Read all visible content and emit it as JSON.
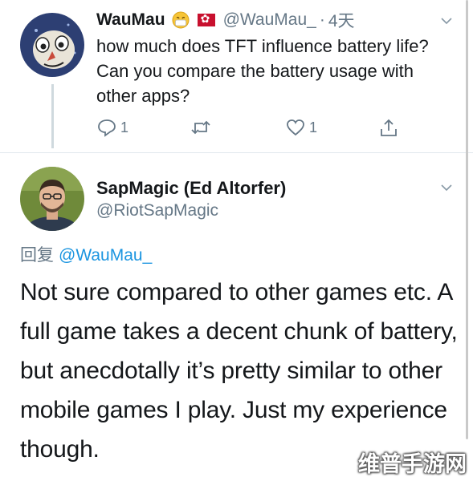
{
  "tweet1": {
    "display_name": "WauMau",
    "handle": "@WauMau_",
    "separator": "·",
    "time": "4天",
    "text": "how much does TFT influence battery life? Can you compare the battery usage with other apps?",
    "reply_count": "1",
    "like_count": "1",
    "badge_icon": "face-with-mask-emoji-icon",
    "flag_icon": "hong-kong-flag-icon"
  },
  "tweet2": {
    "display_name": "SapMagic (Ed Altorfer)",
    "handle": "@RiotSapMagic",
    "reply_prefix": "回复",
    "reply_to": "@WauMau_",
    "text": "Not sure compared to other games etc. A full game takes a decent chunk of battery, but anecdotally it’s pretty similar to other mobile games I play. Just my experience though."
  },
  "watermark": "维普手游网",
  "colors": {
    "secondary_text": "#657786",
    "link": "#1b95e0",
    "divider": "#e1e8ed"
  }
}
